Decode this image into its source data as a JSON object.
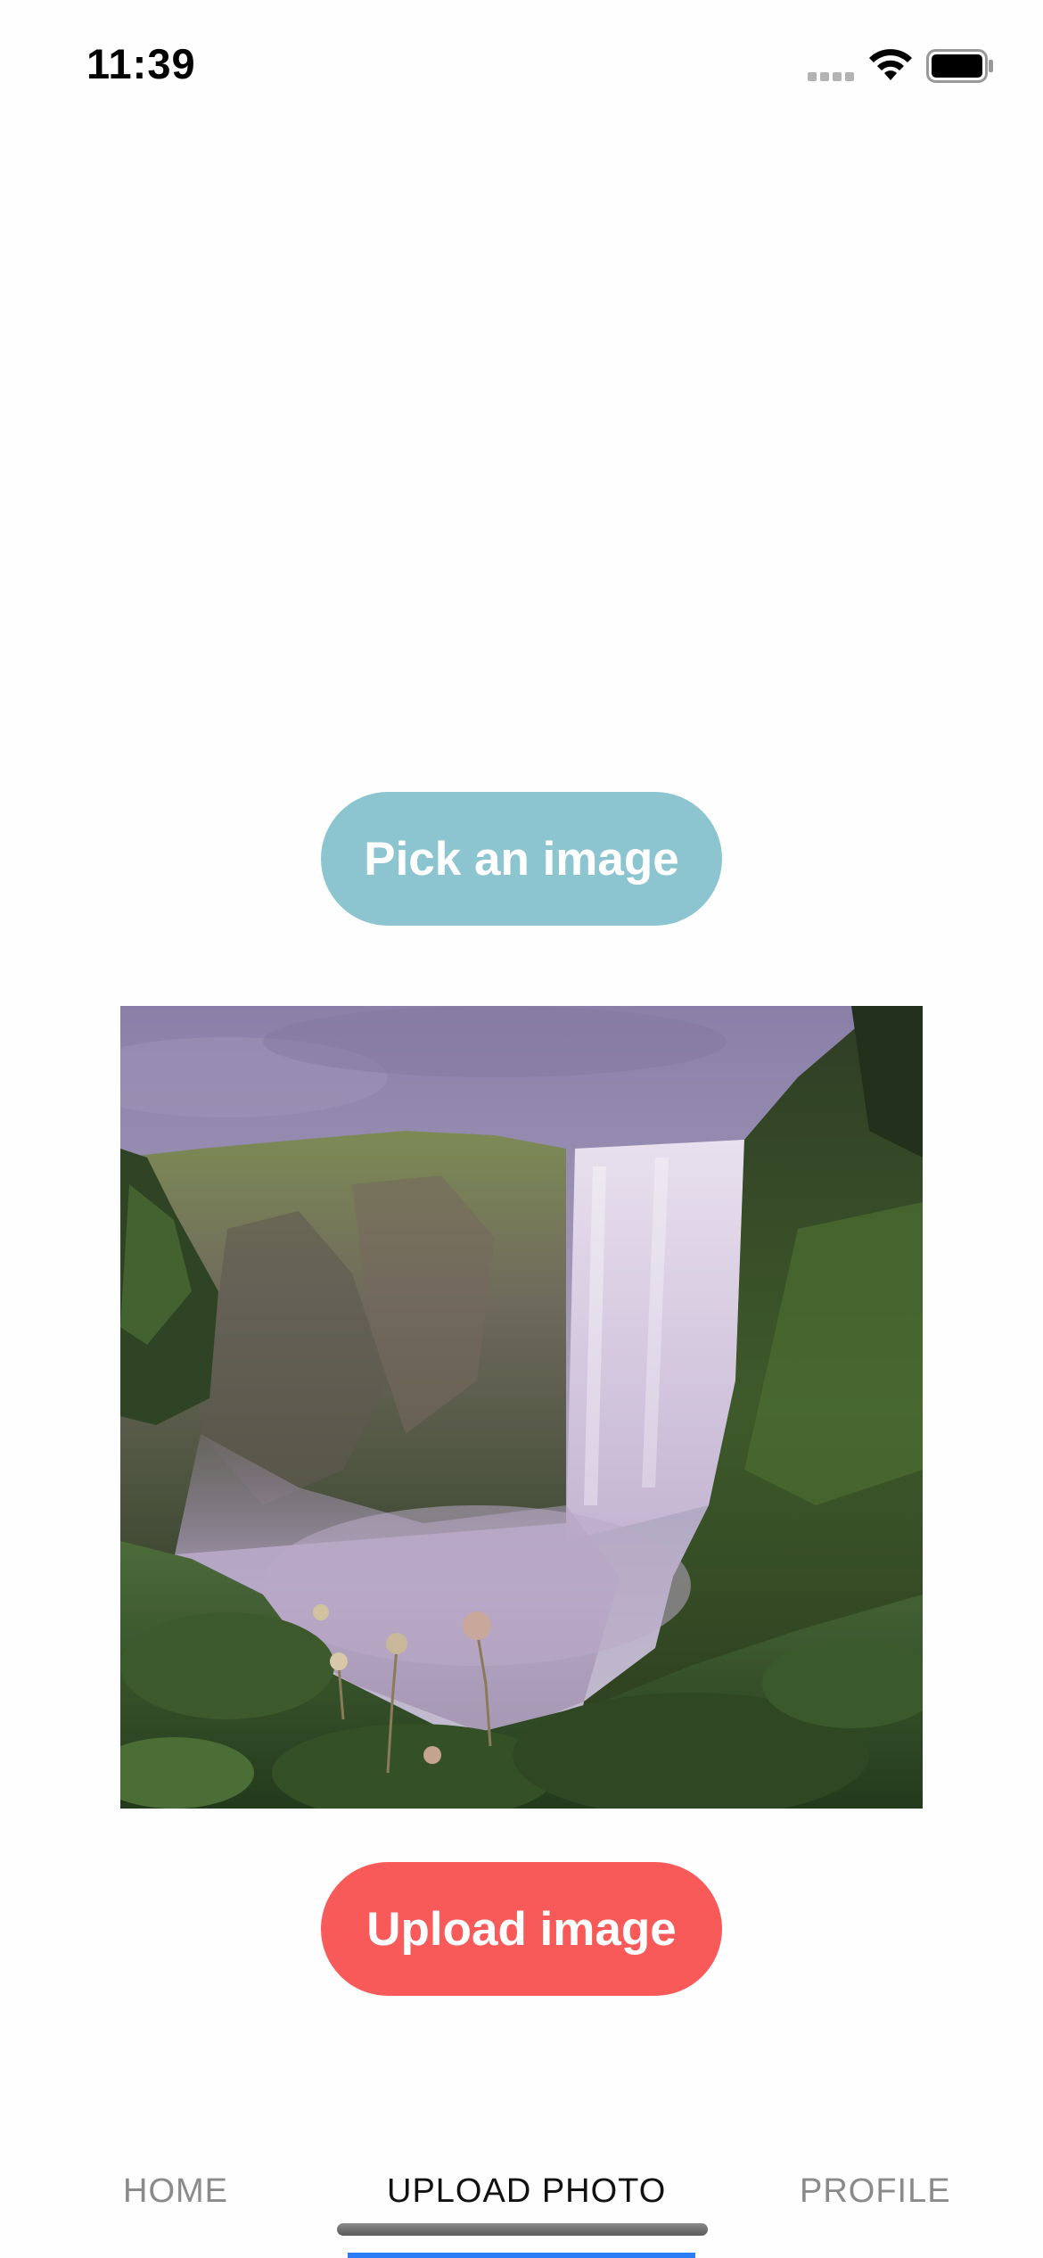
{
  "status_bar": {
    "time": "11:39",
    "icons": [
      "signal-icon",
      "wifi-icon",
      "battery-icon"
    ]
  },
  "actions": {
    "pick_label": "Pick an image",
    "upload_label": "Upload image"
  },
  "preview": {
    "icon": "waterfall-landscape-photo"
  },
  "tabs": [
    {
      "label": "HOME",
      "active": false
    },
    {
      "label": "UPLOAD PHOTO",
      "active": true
    },
    {
      "label": "PROFILE",
      "active": false
    }
  ],
  "colors": {
    "pick_button": "#8cc5d0",
    "upload_button": "#f85a5a",
    "tab_indicator": "#2a7df6",
    "tab_active": "#111111",
    "tab_inactive": "#8a8a8a"
  }
}
